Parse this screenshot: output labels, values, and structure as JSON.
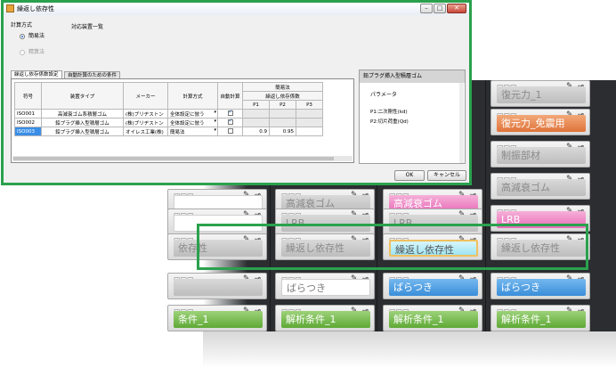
{
  "dialog": {
    "title": "繰返し依存性",
    "window_buttons": {
      "minimize": "–",
      "maximize": "□",
      "close": "✕"
    },
    "calc_method_label": "計算方式",
    "radio_simple": "簡易法",
    "radio_detailed": "精算法",
    "device_list_title": "対応装置一覧",
    "tabs": [
      "繰返し依存係数設定",
      "自動計算のための条件"
    ],
    "grid": {
      "headers": {
        "id": "符号",
        "type": "装置タイプ",
        "maker": "メーカー",
        "method": "計算方式",
        "auto": "自動計算",
        "simple": "簡易法",
        "coef": "繰返し依存係数",
        "p1": "P1",
        "p2": "P2",
        "p3": "P3"
      },
      "rows": [
        {
          "id": "ISO001",
          "type": "高減衰ゴム系積層ゴム",
          "maker": "(株)ブリヂストン",
          "method": "全体設定に倣う",
          "auto": true,
          "p1": "",
          "p2": "",
          "p3": ""
        },
        {
          "id": "ISO002",
          "type": "鉛プラグ挿入型積層ゴム",
          "maker": "(株)ブリヂストン",
          "method": "全体設定に倣う",
          "auto": true,
          "p1": "",
          "p2": "",
          "p3": ""
        },
        {
          "id": "ISO003",
          "type": "鉛プラグ挿入型積層ゴム",
          "maker": "オイレス工業(株)",
          "method": "簡易法",
          "auto": false,
          "p1": "0.9",
          "p2": "0.95",
          "p3": ""
        }
      ]
    },
    "param_panel": {
      "header": "鉛プラグ挿入型積層ゴム",
      "title": "パラメータ",
      "lines": [
        "P1:二次剛性(kd)",
        "P2:切片荷重(Qd)"
      ]
    },
    "ok_label": "OK",
    "cancel_label": "キャンセル"
  },
  "background": {
    "columns": [
      {
        "tiles": [
          {
            "label": "",
            "color": "white"
          },
          {
            "label": "",
            "color": "white"
          },
          {
            "label": "依存性",
            "color": "gray"
          },
          {
            "label": "",
            "color": "gray"
          },
          {
            "label": "条件_1",
            "color": "green"
          }
        ]
      },
      {
        "tiles": [
          {
            "label": "高減衰ゴム",
            "color": "gray"
          },
          {
            "label": "LRB",
            "color": "gray"
          },
          {
            "label": "繰返し依存性",
            "color": "gray"
          },
          {
            "label": "ばらつき",
            "color": "white"
          },
          {
            "label": "解析条件_1",
            "color": "green"
          }
        ]
      },
      {
        "tiles": [
          {
            "label": "高減衰ゴム",
            "color": "pink"
          },
          {
            "label": "LRB",
            "color": "gray"
          },
          {
            "label": "繰返し依存性",
            "color": "cyan"
          },
          {
            "label": "ばらつき",
            "color": "blue"
          },
          {
            "label": "解析条件_1",
            "color": "green"
          }
        ]
      },
      {
        "tiles": [
          {
            "label": "復元力_1",
            "color": "gray"
          },
          {
            "label": "復元力_免震用",
            "color": "orange"
          },
          {
            "label": "制振部材",
            "color": "gray"
          },
          {
            "label": "高減衰ゴム",
            "color": "gray"
          },
          {
            "label": "LRB",
            "color": "pink"
          },
          {
            "label": "繰返し依存性",
            "color": "gray"
          },
          {
            "label": "ばらつき",
            "color": "blue"
          },
          {
            "label": "解析条件_1",
            "color": "green"
          }
        ]
      }
    ]
  }
}
